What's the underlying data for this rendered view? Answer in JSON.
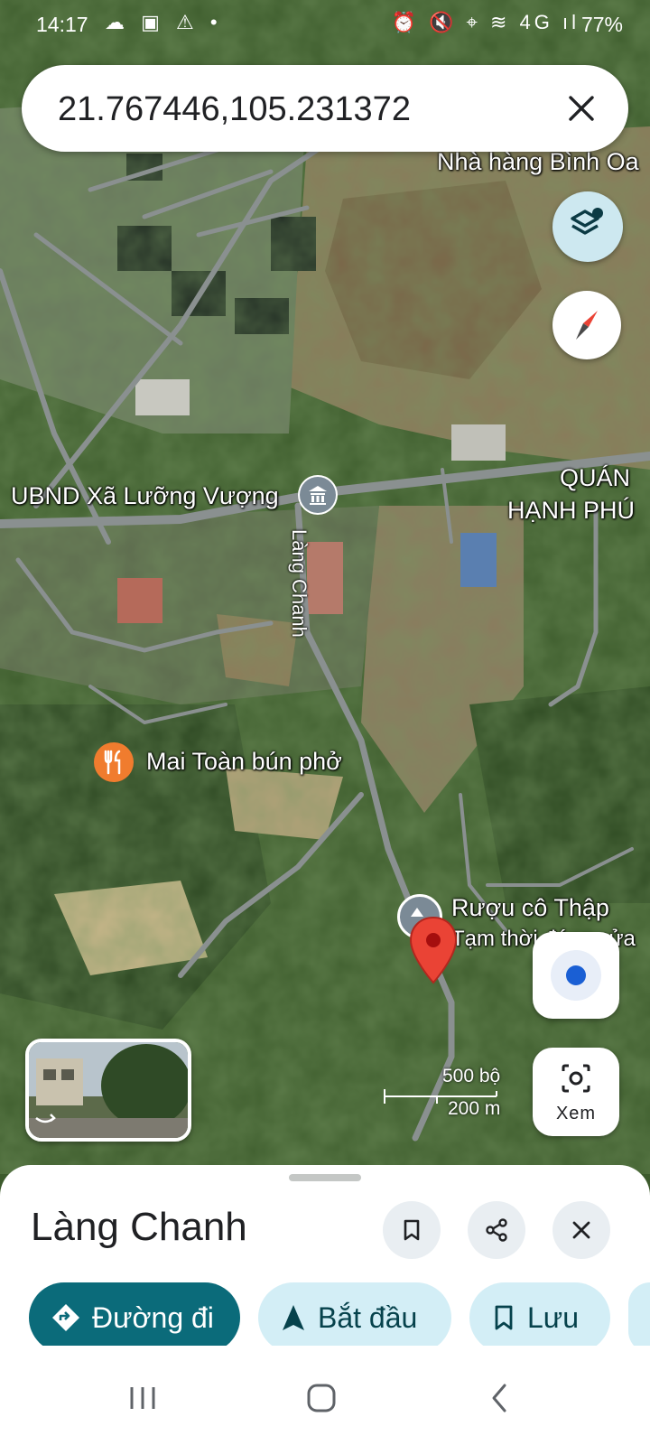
{
  "status_bar": {
    "time": "14:17",
    "left_icons": "☁ ▣ ⚠ •",
    "right_icons": "⏰ 🔇 ⌖ ≋ 4G ıl",
    "battery": "77%"
  },
  "search": {
    "value": "21.767446,105.231372"
  },
  "map_labels": {
    "restaurant_top": "Nhà hàng Bình Oa",
    "ubnd": "UBND Xã Lưỡng Vượng",
    "quan_line1": "QUÁN",
    "quan_line2": "HẠNH PHÚ",
    "road": "Làng Chanh",
    "mai_toan": "Mai Toàn bún phở",
    "ruou_line1": "Rượu cô Thập",
    "ruou_line2": "Tạm thời đóng cửa"
  },
  "scale": {
    "imperial": "500 bộ",
    "metric": "200 m"
  },
  "xem_label": "Xem",
  "place": {
    "title": "Làng Chanh"
  },
  "actions": {
    "directions": "Đường đi",
    "start": "Bắt đầu",
    "save": "Lưu"
  },
  "colors": {
    "primary": "#0b6b7a",
    "chip_bg": "#d3eef6",
    "pin": "#ea4335",
    "poi_orange": "#f07c2e"
  }
}
